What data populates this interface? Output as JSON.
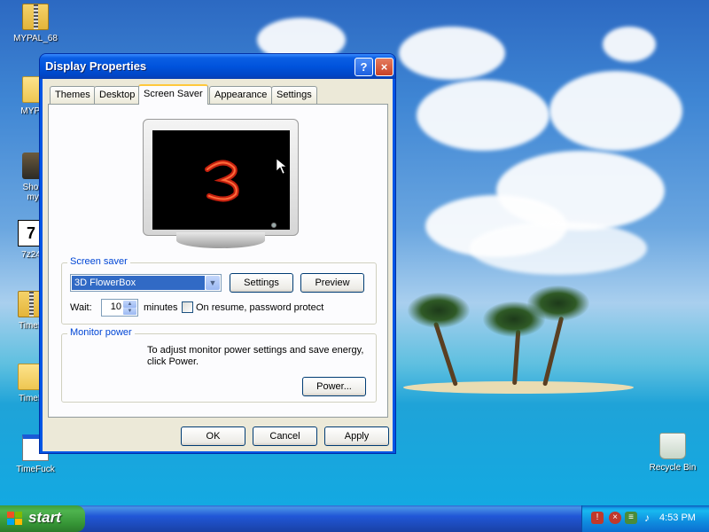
{
  "desktop": {
    "icons": [
      {
        "label": "MYPAL_68",
        "icon": "zip-folder-icon"
      },
      {
        "label": "MYPAL",
        "icon": "folder-icon"
      },
      {
        "label": "Shortc myp",
        "icon": "shortcut-icon"
      },
      {
        "label": "7z24",
        "icon": "7zip-icon"
      },
      {
        "label": "TimeF",
        "icon": "zip-folder-icon"
      },
      {
        "label": "TimeF",
        "icon": "folder-icon"
      },
      {
        "label": "TimeFuck",
        "icon": "document-icon"
      },
      {
        "label": "Recycle Bin",
        "icon": "recycle-bin-icon"
      }
    ]
  },
  "window": {
    "title": "Display Properties",
    "help_label": "?",
    "close_label": "×",
    "tabs": [
      "Themes",
      "Desktop",
      "Screen Saver",
      "Appearance",
      "Settings"
    ],
    "active_tab": "Screen Saver",
    "screen_saver_group": {
      "title": "Screen saver",
      "selected": "3D FlowerBox",
      "settings_label": "Settings",
      "preview_label": "Preview",
      "wait_label": "Wait:",
      "wait_value": "10",
      "minutes_label": "minutes",
      "password_label": "On resume, password protect",
      "password_checked": false
    },
    "monitor_power_group": {
      "title": "Monitor power",
      "description": "To adjust monitor power settings and save energy, click Power.",
      "power_label": "Power..."
    },
    "buttons": {
      "ok": "OK",
      "cancel": "Cancel",
      "apply": "Apply"
    }
  },
  "taskbar": {
    "start_label": "start",
    "clock": "4:53 PM"
  },
  "colors": {
    "accent": "#0055e5",
    "start_green": "#3c9b3c",
    "selection": "#316ac5"
  }
}
